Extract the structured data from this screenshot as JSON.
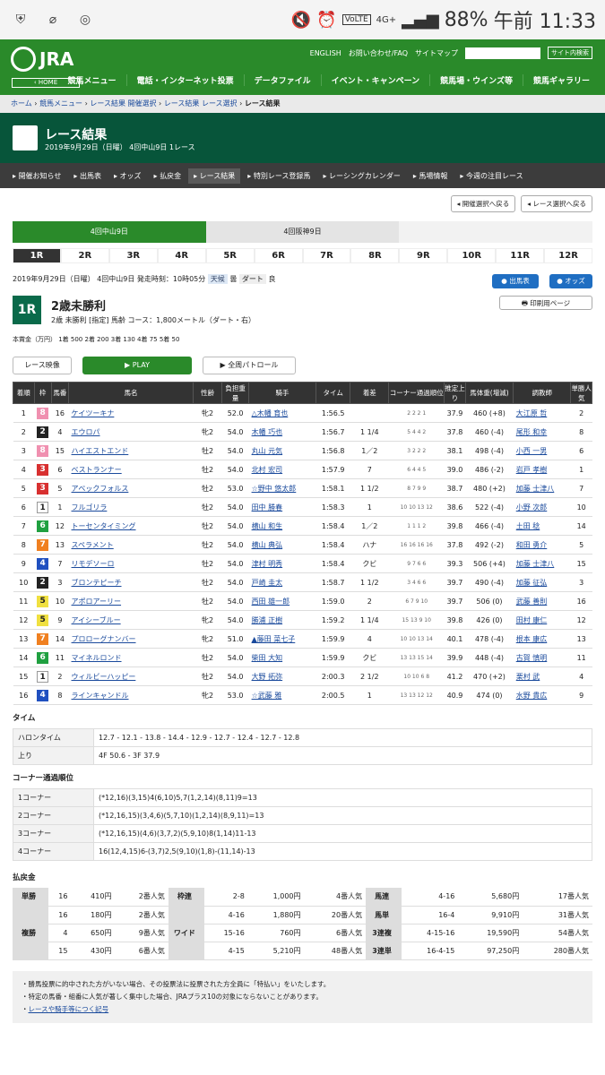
{
  "status": {
    "battery": "88%",
    "time": "午前 11:33",
    "net": "4G+",
    "volte": "VoLTE",
    "on1": "ON",
    "on2": "ON"
  },
  "header": {
    "logo": "JRA",
    "home": "HOME",
    "links": [
      "ENGLISH",
      "お問い合わせ/FAQ",
      "サイトマップ"
    ],
    "search_btn": "サイト内検索",
    "nav": [
      "競馬メニュー",
      "電話・インターネット投票",
      "データファイル",
      "イベント・キャンペーン",
      "競馬場・ウインズ等",
      "競馬ギャラリー"
    ]
  },
  "breadcrumb": [
    "ホーム",
    "競馬メニュー",
    "レース結果 開催選択",
    "レース結果 レース選択",
    "レース結果"
  ],
  "title": {
    "main": "レース結果",
    "sub": "2019年9月29日（日曜） 4回中山9日 1レース"
  },
  "local_nav": [
    "開催お知らせ",
    "出馬表",
    "オッズ",
    "払戻金",
    "レース結果",
    "特別レース登録馬",
    "レーシングカレンダー",
    "馬場情報",
    "今週の注目レース"
  ],
  "nav_buttons": [
    "開催選択へ戻る",
    "レース選択へ戻る"
  ],
  "venues": [
    "4回中山9日",
    "4回阪神9日",
    ""
  ],
  "races": [
    "1R",
    "2R",
    "3R",
    "4R",
    "5R",
    "6R",
    "7R",
    "8R",
    "9R",
    "10R",
    "11R",
    "12R"
  ],
  "race": {
    "date": "2019年9月29日（日曜） 4回中山9日 発走時刻：10時05分",
    "weather_label": "天候",
    "weather": "曇",
    "track_label": "ダート",
    "track": "良",
    "num": "1R",
    "name": "2歳未勝利",
    "sub": "2歳 未勝利 [指定] 馬齢 コース：1,800メートル（ダート・右）",
    "prize": "本賞金（万円） 1着 500 2着 200 3着 130 4着 75 5着 50",
    "btn_card": "出馬表",
    "btn_odds": "オッズ",
    "btn_print": "印刷用ページ"
  },
  "video": {
    "label": "レース映像",
    "play": "PLAY",
    "patrol": "全周パトロール"
  },
  "table": {
    "headers": [
      "着順",
      "枠",
      "馬番",
      "馬名",
      "性齢",
      "負担重量",
      "騎手",
      "タイム",
      "着差",
      "コーナー通過順位",
      "推定上り",
      "馬体重(増減)",
      "調教師",
      "単勝人気"
    ],
    "rows": [
      [
        "1",
        "8",
        "16",
        "ケイツーキナ",
        "牝2",
        "52.0",
        "△木幡 育也",
        "1:56.5",
        "",
        "2 2 2 1",
        "37.9",
        "460 (+8)",
        "大江原 哲",
        "2"
      ],
      [
        "2",
        "2",
        "4",
        "エウロパ",
        "牝2",
        "54.0",
        "木幡 巧也",
        "1:56.7",
        "1 1/4",
        "5 4 4 2",
        "37.8",
        "460 (-4)",
        "尾形 和幸",
        "8"
      ],
      [
        "3",
        "8",
        "15",
        "ハイエストエンド",
        "牡2",
        "54.0",
        "丸山 元気",
        "1:56.8",
        "1／2",
        "3 2 2 2",
        "38.1",
        "498 (-4)",
        "小西 一男",
        "6"
      ],
      [
        "4",
        "3",
        "6",
        "ベストランナー",
        "牡2",
        "54.0",
        "北村 宏司",
        "1:57.9",
        "7",
        "6 4 4 5",
        "39.0",
        "486 (-2)",
        "岩戸 孝樹",
        "1"
      ],
      [
        "5",
        "3",
        "5",
        "アベックフォルス",
        "牡2",
        "53.0",
        "☆野中 悠太郎",
        "1:58.1",
        "1 1/2",
        "8 7 9 9",
        "38.7",
        "480 (+2)",
        "加藤 士津八",
        "7"
      ],
      [
        "6",
        "1",
        "1",
        "フルゴリラ",
        "牡2",
        "54.0",
        "田中 勝春",
        "1:58.3",
        "1",
        "10 10 13 12",
        "38.6",
        "522 (-4)",
        "小野 次郎",
        "10"
      ],
      [
        "7",
        "6",
        "12",
        "トーセンタイミング",
        "牡2",
        "54.0",
        "横山 和生",
        "1:58.4",
        "1／2",
        "1 1 1 2",
        "39.8",
        "466 (-4)",
        "土田 稔",
        "14"
      ],
      [
        "8",
        "7",
        "13",
        "スペラメント",
        "牡2",
        "54.0",
        "横山 典弘",
        "1:58.4",
        "ハナ",
        "16 16 16 16",
        "37.8",
        "492 (-2)",
        "和田 勇介",
        "5"
      ],
      [
        "9",
        "4",
        "7",
        "リモデソーロ",
        "牡2",
        "54.0",
        "津村 明秀",
        "1:58.4",
        "クビ",
        "9 7 6 6",
        "39.3",
        "506 (+4)",
        "加藤 士津八",
        "15"
      ],
      [
        "10",
        "2",
        "3",
        "ブロンテピーチ",
        "牡2",
        "54.0",
        "戸崎 圭太",
        "1:58.7",
        "1 1/2",
        "3 4 6 6",
        "39.7",
        "490 (-4)",
        "加藤 征弘",
        "3"
      ],
      [
        "11",
        "5",
        "10",
        "アポロアーリー",
        "牡2",
        "54.0",
        "西田 雄一郎",
        "1:59.0",
        "2",
        "6 7 9 10",
        "39.7",
        "506 (0)",
        "武藤 善則",
        "16"
      ],
      [
        "12",
        "5",
        "9",
        "アイシーブルー",
        "牝2",
        "54.0",
        "勝浦 正樹",
        "1:59.2",
        "1 1/4",
        "15 13 9 10",
        "39.8",
        "426 (0)",
        "田村 康仁",
        "12"
      ],
      [
        "13",
        "7",
        "14",
        "プロローグナンバー",
        "牝2",
        "51.0",
        "▲藤田 菜七子",
        "1:59.9",
        "4",
        "10 10 13 14",
        "40.1",
        "478 (-4)",
        "根本 康広",
        "13"
      ],
      [
        "14",
        "6",
        "11",
        "マイネルロンド",
        "牡2",
        "54.0",
        "柴田 大知",
        "1:59.9",
        "クビ",
        "13 13 15 14",
        "39.9",
        "448 (-4)",
        "古賀 慎明",
        "11"
      ],
      [
        "15",
        "1",
        "2",
        "ウィルビーハッピー",
        "牡2",
        "54.0",
        "大野 拓弥",
        "2:00.3",
        "2 1/2",
        "10 10 6 8",
        "41.2",
        "470 (+2)",
        "栗村 武",
        "4"
      ],
      [
        "16",
        "4",
        "8",
        "ラインキャンドル",
        "牝2",
        "53.0",
        "☆武藤 雅",
        "2:00.5",
        "1",
        "13 13 12 12",
        "40.9",
        "474 (0)",
        "水野 貴広",
        "9"
      ]
    ]
  },
  "waku_colors": {
    "1": "#ffffff",
    "2": "#222222",
    "3": "#d83030",
    "4": "#2050c0",
    "5": "#f0e040",
    "6": "#20a040",
    "7": "#f08020",
    "8": "#f090b0"
  },
  "time_sec": {
    "title": "タイム",
    "rows": [
      [
        "ハロンタイム",
        "12.7 - 12.1 - 13.8 - 14.4 - 12.9 - 12.7 - 12.4 - 12.7 - 12.8"
      ],
      [
        "上り",
        "4F 50.6 - 3F 37.9"
      ]
    ]
  },
  "corner_sec": {
    "title": "コーナー通過順位",
    "rows": [
      [
        "1コーナー",
        "(*12,16)(3,15)4(6,10)5,7(1,2,14)(8,11)9=13"
      ],
      [
        "2コーナー",
        "(*12,16,15)(3,4,6)(5,7,10)(1,2,14)(8,9,11)=13"
      ],
      [
        "3コーナー",
        "(*12,16,15)(4,6)(3,7,2)(5,9,10)8(1,14)11-13"
      ],
      [
        "4コーナー",
        "16(12,4,15)6-(3,7)2,5(9,10)(1,8)-(11,14)-13"
      ]
    ]
  },
  "payout": {
    "title": "払戻金",
    "rows": [
      [
        "単勝",
        "16",
        "410円",
        "2番人気",
        "枠連",
        "2-8",
        "1,000円",
        "4番人気",
        "馬連",
        "4-16",
        "5,680円",
        "17番人気"
      ],
      [
        "",
        "16",
        "180円",
        "2番人気",
        "",
        "4-16",
        "1,880円",
        "20番人気",
        "馬単",
        "16-4",
        "9,910円",
        "31番人気"
      ],
      [
        "複勝",
        "4",
        "650円",
        "9番人気",
        "ワイド",
        "15-16",
        "760円",
        "6番人気",
        "3連複",
        "4-15-16",
        "19,590円",
        "54番人気"
      ],
      [
        "",
        "15",
        "430円",
        "6番人気",
        "",
        "4-15",
        "5,210円",
        "48番人気",
        "3連単",
        "16-4-15",
        "97,250円",
        "280番人気"
      ]
    ]
  },
  "notes": [
    "勝馬投票に的中された方がいない場合、その投票法に投票された方全員に「特払い」をいたします。",
    "特定の馬番・組番に人気が著しく集中した場合、JRAプラス10の対象にならないことがあります。",
    "レースや騎手等につく記号"
  ]
}
